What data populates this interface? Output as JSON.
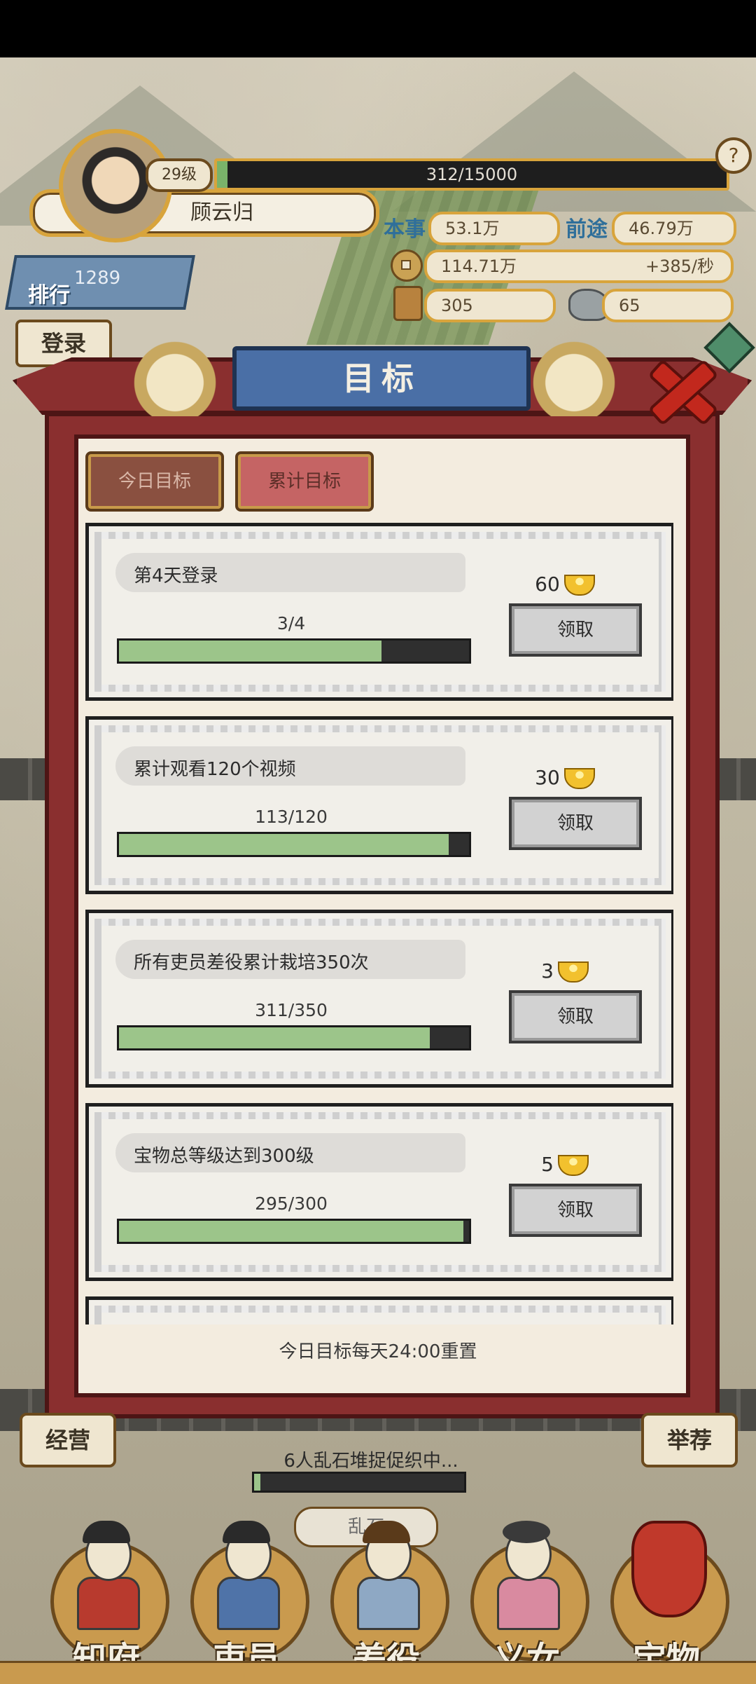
{
  "player": {
    "level": "29级",
    "exp_text": "312/15000",
    "exp_fraction": 0.0208,
    "name": "顾云归"
  },
  "stats": {
    "skill_label": "本事",
    "skill_value": "53.1万",
    "prospect_label": "前途",
    "prospect_value": "46.79万",
    "coins": "114.71万",
    "coin_rate": "+385/秒",
    "tokens": "305",
    "stone": "65"
  },
  "rank": {
    "label": "排行",
    "value": "1289"
  },
  "login_tab": "登录",
  "dialog": {
    "title": "目标",
    "tabs": [
      "今日目标",
      "累计目标"
    ],
    "selected_tab": "累计目标",
    "goals": [
      {
        "title": "第4天登录",
        "progress_text": "3/4",
        "progress": 0.75,
        "reward": "60",
        "button": "领取"
      },
      {
        "title": "累计观看120个视频",
        "progress_text": "113/120",
        "progress": 0.9417,
        "reward": "30",
        "button": "领取"
      },
      {
        "title": "所有吏员差役累计栽培350次",
        "progress_text": "311/350",
        "progress": 0.8886,
        "reward": "3",
        "button": "领取"
      },
      {
        "title": "宝物总等级达到300级",
        "progress_text": "295/300",
        "progress": 0.9833,
        "reward": "5",
        "button": "领取"
      }
    ],
    "footer_note": "今日目标每天24:00重置"
  },
  "side": {
    "left_label": "经营",
    "right_label": "举荐"
  },
  "event": {
    "text": "6人乱石堆捉促织中...",
    "progress": 0.03,
    "button": "乱石"
  },
  "bottom_nav": [
    "知府",
    "吏员",
    "差役",
    "义女",
    "宝物"
  ],
  "colors": {
    "accent_gold": "#d8a43c",
    "dialog_red": "#8a2f2f",
    "title_blue": "#4a6fa6",
    "progress_green": "#9cc58a"
  }
}
